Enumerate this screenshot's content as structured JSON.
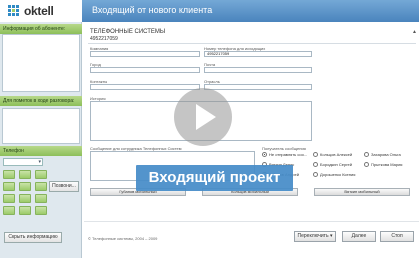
{
  "brand": {
    "name": "oktell"
  },
  "window": {
    "title": "Входящий от нового клиента"
  },
  "sidebar": {
    "subscriber_info_label": "Информация об абоненте:",
    "call_notes_label": "Для пометок в ходе разговора:",
    "phone_label": "Телефон",
    "phone_select_value": "",
    "call_button_label": "Позвони...",
    "hide_info_button_label": "Скрыть информацию"
  },
  "form": {
    "section_title": "ТЕЛЕФОННЫЕ СИСТЕМЫ",
    "collapse_label": "▲",
    "phone_number": "4952217059",
    "company_label": "Компания",
    "company_value": "",
    "contact_phone_label": "Номер телефона для исходящих",
    "contact_phone_value": "4952217059",
    "city_label": "Город",
    "city_value": "",
    "email_label": "Почта",
    "email_value": "",
    "contacts_label": "Контакты",
    "contacts_value": "",
    "industry_label": "Отрасль",
    "industry_value": "",
    "history_label": "История",
    "message_label": "Сообщение для сотрудника Телефонных Систем",
    "recipient_label": "Получатель сообщения"
  },
  "recipients": [
    {
      "label": "Не отправлять соо...",
      "checked": true
    },
    {
      "label": "Кольцов Алексей",
      "checked": false
    },
    {
      "label": "Захарова Ольга",
      "checked": false
    },
    {
      "label": "Вяткин Денис",
      "checked": false
    },
    {
      "label": "Бородкин Сергей",
      "checked": false
    },
    {
      "label": "Прыткова Мария",
      "checked": false
    },
    {
      "label": "Губанов Андрей",
      "checked": false
    },
    {
      "label": "Дорошенко Ксения",
      "checked": false
    }
  ],
  "quick_buttons": [
    "Губанов мобильный",
    "Кольцов мобильный",
    "Вяткин мобильный"
  ],
  "footer": {
    "copyright": "© Телефонные системы, 2004 – 2009",
    "switch_label": "Переключить ▾",
    "next_label": "Далее",
    "stop_label": "Стоп"
  },
  "overlay": {
    "banner_text": "Входящий проект"
  },
  "colors": {
    "titlebar": "#5b93c9",
    "section_head": "#9fcb6e",
    "banner": "#468cc8"
  }
}
